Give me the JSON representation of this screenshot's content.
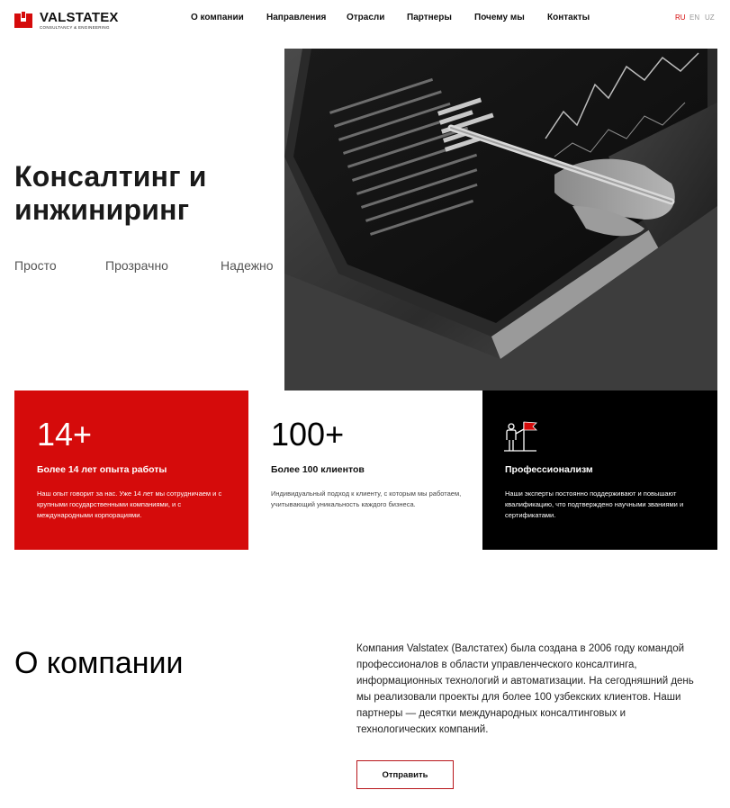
{
  "header": {
    "logo": {
      "name": "VALSTATEX",
      "tagline": "CONSULTANCY & ENGINEERING"
    },
    "nav": [
      {
        "label": "О компании"
      },
      {
        "label": "Направления"
      },
      {
        "label": "Отрасли"
      },
      {
        "label": "Партнеры"
      },
      {
        "label": "Почему мы"
      },
      {
        "label": "Контакты"
      }
    ],
    "languages": [
      {
        "code": "RU",
        "active": true
      },
      {
        "code": "EN",
        "active": false
      },
      {
        "code": "UZ",
        "active": false
      }
    ]
  },
  "hero": {
    "title": "Консалтинг и инжиниринг",
    "taglines": [
      "Просто",
      "Прозрачно",
      "Надежно"
    ]
  },
  "stats": [
    {
      "number": "14+",
      "title": "Более 14 лет опыта работы",
      "text": "Наш опыт говорит за нас. Уже 14 лет мы сотрудничаем и с крупными государственными компаниями, и с международными корпорациями."
    },
    {
      "number": "100+",
      "title": "Более 100 клиентов",
      "text": "Индивидуальный подход к клиенту, с которым мы работаем, учитывающий уникальность каждого бизнеса."
    },
    {
      "icon": "expert-flag-icon",
      "title": "Профессионализм",
      "text": "Наши эксперты постоянно поддерживают и повышают квалификацию, что подтверждено научными званиями и сертификатами."
    }
  ],
  "about": {
    "title": "О компании",
    "text": "Компания Valstatex (Валстатех) была создана в 2006 году командой профессионалов в области управленческого консалтинга, информационных технологий и автоматизации. На сегодняшний день мы реализовали проекты для более 100 узбекских клиентов. Наши партнеры — десятки международных консалтинговых и технологических компаний.",
    "button_label": "Отправить"
  },
  "colors": {
    "accent": "#d50b0b",
    "dark": "#000000",
    "text": "#111111"
  }
}
